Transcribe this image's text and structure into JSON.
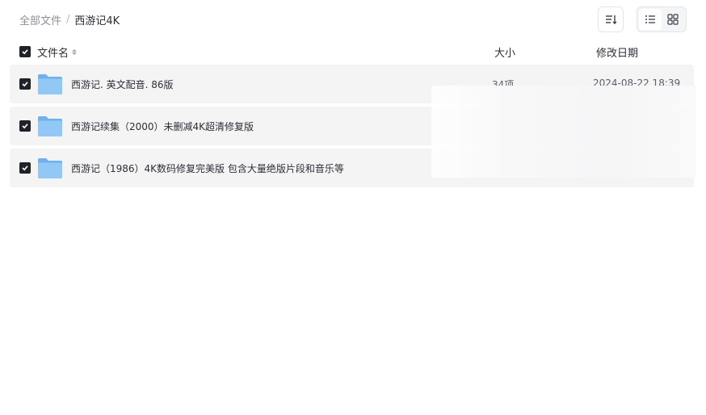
{
  "breadcrumb": {
    "root": "全部文件",
    "separator": "/",
    "current": "西游记4K"
  },
  "toolbar": {
    "sort_icon": "sort-lines-icon",
    "view_list_icon": "list-view-icon",
    "view_grid_icon": "grid-view-icon",
    "active_view": "list"
  },
  "table": {
    "headers": {
      "name": "文件名",
      "size": "大小",
      "date": "修改日期"
    },
    "rows": [
      {
        "name": "西游记. 英文配音. 86版",
        "size": "34项",
        "date": "2024-08-22 18:39",
        "checked": true,
        "icon": "folder-icon"
      },
      {
        "name": "西游记续集（2000）未删减4K超清修复版",
        "size": "",
        "date": "",
        "checked": true,
        "icon": "folder-icon"
      },
      {
        "name": "西游记（1986）4K数码修复完美版 包含大量绝版片段和音乐等",
        "size": "",
        "date": "",
        "checked": true,
        "icon": "folder-icon"
      }
    ]
  },
  "colors": {
    "row_background": "#f4f4f5",
    "checkbox": "#1f2329",
    "folder": "#7cb9f0"
  }
}
